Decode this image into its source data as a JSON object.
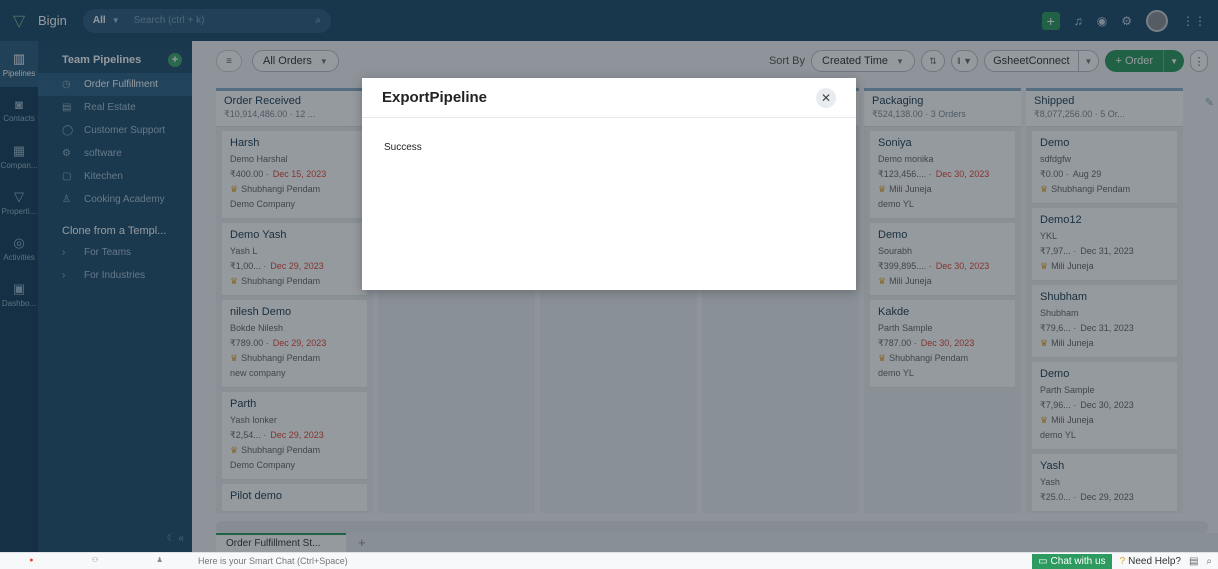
{
  "app": {
    "name": "Bigin"
  },
  "search": {
    "scope": "All",
    "placeholder": "Search (ctrl + k)"
  },
  "rail": [
    {
      "icon": "pipelines-icon",
      "label": "Pipelines"
    },
    {
      "icon": "contacts-icon",
      "label": "Contacts"
    },
    {
      "icon": "companies-icon",
      "label": "Compan..."
    },
    {
      "icon": "properties-icon",
      "label": "Properti..."
    },
    {
      "icon": "activities-icon",
      "label": "Activities"
    },
    {
      "icon": "dashboards-icon",
      "label": "Dashbo..."
    }
  ],
  "sidebar": {
    "heading": "Team Pipelines",
    "items": [
      {
        "label": "Order Fulfillment",
        "glyph": "◷"
      },
      {
        "label": "Real Estate",
        "glyph": "▤"
      },
      {
        "label": "Customer Support",
        "glyph": "◯"
      },
      {
        "label": "software",
        "glyph": "⚙"
      },
      {
        "label": "Kitechen",
        "glyph": "▢"
      },
      {
        "label": "Cooking Academy",
        "glyph": "♙"
      }
    ],
    "clone_heading": "Clone from a Templ...",
    "clone_items": [
      "For Teams",
      "For Industries"
    ]
  },
  "toolbar": {
    "view": "All Orders",
    "sort_by_label": "Sort By",
    "sort_value": "Created Time",
    "gsheet": "GsheetConnect",
    "add_order": "+ Order"
  },
  "columns": [
    {
      "title": "Order Received",
      "summary": "₹10,914,486.00 · 12 ...",
      "cards": [
        {
          "title": "Harsh",
          "contact": "Demo Harshal",
          "amount": "₹400.00 ·",
          "date": "Dec 15, 2023",
          "owner": "Shubhangi Pendam",
          "company": "Demo Company"
        },
        {
          "title": "Demo Yash",
          "contact": "Yash L",
          "amount": "₹1,00... ·",
          "date": "Dec 29, 2023",
          "owner": "Shubhangi Pendam",
          "company": ""
        },
        {
          "title": "nilesh Demo",
          "contact": "Bokde Nilesh",
          "amount": "₹789.00 ·",
          "date": "Dec 29, 2023",
          "owner": "Shubhangi Pendam",
          "company": "new company"
        },
        {
          "title": "Parth",
          "contact": "Yash lonker",
          "amount": "₹2,54... ·",
          "date": "Dec 29, 2023",
          "owner": "Shubhangi Pendam",
          "company": "Demo Company"
        },
        {
          "title": "Pilot demo",
          "contact": "",
          "amount": "",
          "date": "",
          "owner": "",
          "company": ""
        }
      ]
    },
    {
      "title": "",
      "summary": "",
      "cards": []
    },
    {
      "title": "",
      "summary": "",
      "cards": []
    },
    {
      "title": "",
      "summary": "",
      "cards": []
    },
    {
      "title": "Packaging",
      "summary": "₹524,138.00 · 3 Orders",
      "cards": [
        {
          "title": "Soniya",
          "contact": "Demo monika",
          "amount": "₹123,456.... ·",
          "date": "Dec 30, 2023",
          "owner": "Mili Juneja",
          "company": "demo YL"
        },
        {
          "title": "Demo",
          "contact": "Sourabh",
          "amount": "₹399,895.... ·",
          "date": "Dec 30, 2023",
          "owner": "Mili Juneja",
          "company": ""
        },
        {
          "title": "Kakde",
          "contact": "Parth Sample",
          "amount": "₹787.00 ·",
          "date": "Dec 30, 2023",
          "owner": "Shubhangi Pendam",
          "company": "demo YL"
        }
      ]
    },
    {
      "title": "Shipped",
      "summary": "₹8,077,256.00 · 5 Or...",
      "cards": [
        {
          "title": "Demo",
          "contact": "sdfdgfw",
          "amount": "₹0.00 ·",
          "date": "Aug 29",
          "owner": "Shubhangi Pendam",
          "company": ""
        },
        {
          "title": "Demo12",
          "contact": "YKL",
          "amount": "₹7,97... ·",
          "date": "Dec 31, 2023",
          "owner": "Mili Juneja",
          "company": ""
        },
        {
          "title": "Shubham",
          "contact": "Shubham",
          "amount": "₹79,6... ·",
          "date": "Dec 31, 2023",
          "owner": "Mili Juneja",
          "company": ""
        },
        {
          "title": "Demo",
          "contact": "Parth Sample",
          "amount": "₹7,96... ·",
          "date": "Dec 30, 2023",
          "owner": "Mili Juneja",
          "company": "demo YL"
        },
        {
          "title": "Yash",
          "contact": "Yash",
          "amount": "₹25.0... ·",
          "date": "Dec 29, 2023",
          "owner": "",
          "company": ""
        }
      ]
    }
  ],
  "tabs": {
    "active": "Order Fulfillment St..."
  },
  "bottom": {
    "chat_placeholder": "Here is your Smart Chat (Ctrl+Space)",
    "chat_with_us": "Chat with us",
    "need_help": "Need Help?"
  },
  "modal": {
    "title": "ExportPipeline",
    "message": "Success"
  }
}
